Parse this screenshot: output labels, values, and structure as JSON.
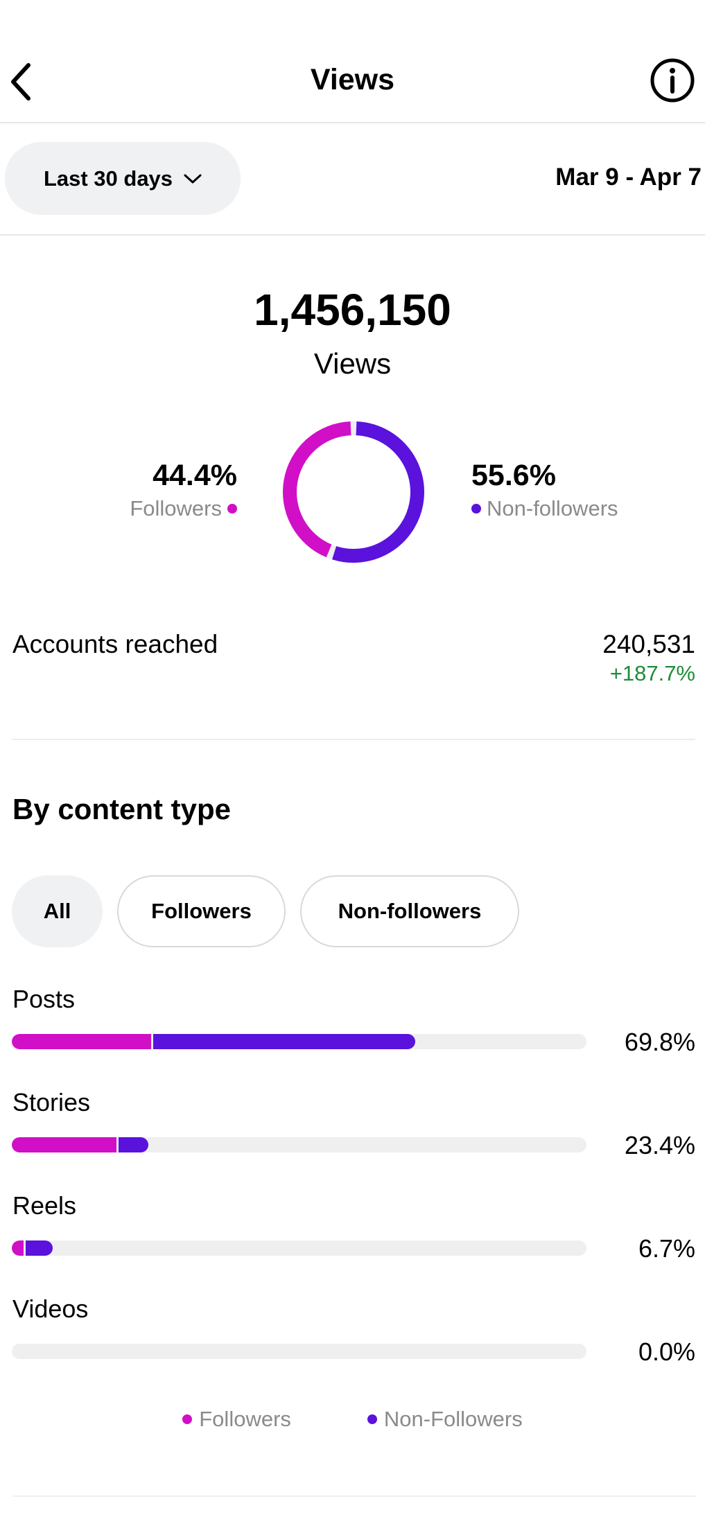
{
  "header": {
    "title": "Views",
    "back_icon": "chevron-left-icon",
    "info_icon": "info-icon"
  },
  "filter": {
    "range_label": "Last 30 days",
    "range_icon": "chevron-down-icon",
    "date_range": "Mar 9 - Apr 7"
  },
  "summary": {
    "total_views": "1,456,150",
    "views_label": "Views",
    "followers": {
      "percent": "44.4%",
      "label": "Followers",
      "value": 44.4
    },
    "non_followers": {
      "percent": "55.6%",
      "label": "Non-followers",
      "value": 55.6
    }
  },
  "accounts_reached": {
    "label": "Accounts reached",
    "value": "240,531",
    "change": "+187.7%"
  },
  "content_type": {
    "title": "By content type",
    "chips": [
      "All",
      "Followers",
      "Non-followers"
    ],
    "selected_chip": "All",
    "rows": [
      {
        "label": "Posts",
        "percent": "69.8%",
        "followers_share": 24.2,
        "non_followers_share": 45.6
      },
      {
        "label": "Stories",
        "percent": "23.4%",
        "followers_share": 18.2,
        "non_followers_share": 5.2
      },
      {
        "label": "Reels",
        "percent": "6.7%",
        "followers_share": 2.0,
        "non_followers_share": 4.7
      },
      {
        "label": "Videos",
        "percent": "0.0%",
        "followers_share": 0,
        "non_followers_share": 0
      }
    ]
  },
  "legend": {
    "followers": "Followers",
    "non_followers": "Non-Followers"
  },
  "colors": {
    "followers": "#d10fc7",
    "non_followers": "#5a12dc",
    "positive": "#1f8b3a"
  }
}
